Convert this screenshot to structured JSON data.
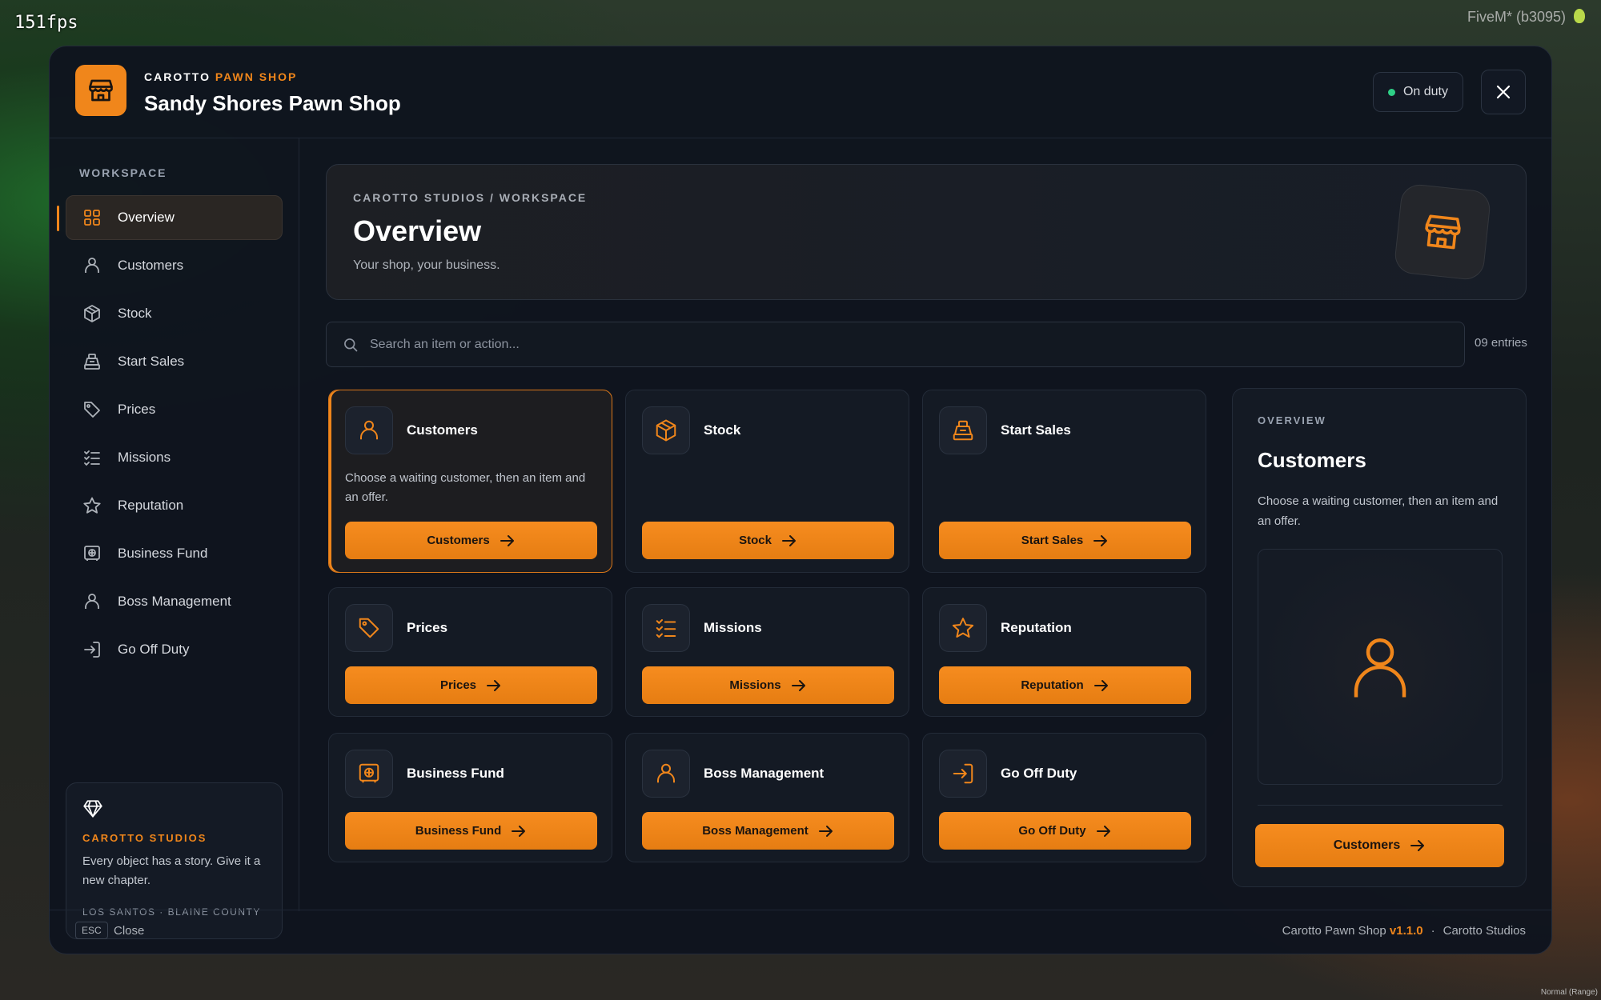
{
  "overlay": {
    "fps": "151fps",
    "client": "FiveM* (b3095)",
    "corner": "Normal (Range)"
  },
  "header": {
    "brand_prefix": "CAROTTO",
    "brand_accent": "PAWN SHOP",
    "shop_name": "Sandy Shores Pawn Shop",
    "duty_status": "On duty"
  },
  "sidebar": {
    "title": "WORKSPACE",
    "items": [
      {
        "label": "Overview",
        "icon": "grid-icon"
      },
      {
        "label": "Customers",
        "icon": "person-icon"
      },
      {
        "label": "Stock",
        "icon": "box-icon"
      },
      {
        "label": "Start Sales",
        "icon": "register-icon"
      },
      {
        "label": "Prices",
        "icon": "tag-icon"
      },
      {
        "label": "Missions",
        "icon": "checklist-icon"
      },
      {
        "label": "Reputation",
        "icon": "star-icon"
      },
      {
        "label": "Business Fund",
        "icon": "safe-icon"
      },
      {
        "label": "Boss Management",
        "icon": "person-icon"
      },
      {
        "label": "Go Off Duty",
        "icon": "exit-icon"
      }
    ],
    "promo": {
      "title": "CAROTTO STUDIOS",
      "text": "Every object has a story. Give it a new chapter.",
      "location": "LOS SANTOS · BLAINE COUNTY"
    }
  },
  "hero": {
    "crumb": "CAROTTO STUDIOS / WORKSPACE",
    "title": "Overview",
    "subtitle": "Your shop, your business."
  },
  "search": {
    "placeholder": "Search an item or action...",
    "value": "",
    "entries": "09 entries"
  },
  "cards": [
    {
      "title": "Customers",
      "desc": "Choose a waiting customer, then an item and an offer.",
      "button": "Customers",
      "icon": "person-icon"
    },
    {
      "title": "Stock",
      "desc": "",
      "button": "Stock",
      "icon": "box-icon"
    },
    {
      "title": "Start Sales",
      "desc": "",
      "button": "Start Sales",
      "icon": "register-icon"
    },
    {
      "title": "Prices",
      "desc": "",
      "button": "Prices",
      "icon": "tag-icon"
    },
    {
      "title": "Missions",
      "desc": "",
      "button": "Missions",
      "icon": "checklist-icon"
    },
    {
      "title": "Reputation",
      "desc": "",
      "button": "Reputation",
      "icon": "star-icon"
    },
    {
      "title": "Business Fund",
      "desc": "",
      "button": "Business Fund",
      "icon": "safe-icon"
    },
    {
      "title": "Boss Management",
      "desc": "",
      "button": "Boss Management",
      "icon": "person-icon"
    },
    {
      "title": "Go Off Duty",
      "desc": "",
      "button": "Go Off Duty",
      "icon": "exit-icon"
    }
  ],
  "detail": {
    "label": "OVERVIEW",
    "title": "Customers",
    "desc": "Choose a waiting customer, then an item and an offer.",
    "button": "Customers"
  },
  "footer": {
    "esc_key": "ESC",
    "esc_label": "Close",
    "product": "Carotto Pawn Shop",
    "version": "v1.1.0",
    "separator": "·",
    "studio": "Carotto Studios"
  },
  "colors": {
    "accent": "#f0861b",
    "online": "#2ecf86",
    "panel": "#0f141e"
  }
}
